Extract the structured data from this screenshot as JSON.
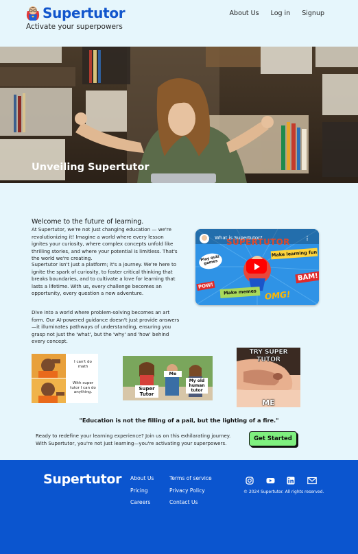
{
  "brand": {
    "name": "Supertutor",
    "tagline": "Activate your superpowers"
  },
  "nav": {
    "items": [
      "About Us",
      "Log in",
      "Signup"
    ]
  },
  "hero": {
    "title": "Unveiling Supertutor"
  },
  "intro": {
    "heading": "Welcome to the future of learning.",
    "paragraphs": [
      "At Supertutor, we're not just changing education — we're revolutionizing it! Imagine a world where every lesson ignites your curiosity, where complex concepts unfold like thrilling stories, and where your potential is limitless. That's the world we're creating.",
      "Supertutor isn't just a platform; it's a journey. We're here to ignite the spark of curiosity, to foster critical thinking that breaks boundaries, and to cultivate a love for learning that lasts a lifetime. With us, every challenge becomes an opportunity, every question a new adventure.",
      "Dive into a world where problem-solving becomes an art form. Our AI-powered guidance doesn't just provide answers—it illuminates pathways of understanding, ensuring you grasp not just the 'what', but the 'why' and 'how' behind every concept."
    ]
  },
  "video": {
    "title": "What is Supertutor?",
    "banner": "SUPERTUTOR",
    "stickers": [
      "Play quiz games",
      "Make learning fun",
      "Make memes",
      "OMG!",
      "BAM!",
      "POW!"
    ]
  },
  "memes": {
    "drake": {
      "top_caption": "I can't do math",
      "bottom_caption": "With super tutor I can do anything."
    },
    "distracted": {
      "left_label": "Super Tutor",
      "middle_label": "Me",
      "right_label": "My old human tutor"
    },
    "ear": {
      "top_text": "TRY SUPER TUTOR",
      "bottom_text": "ME"
    }
  },
  "quote": "\"Education is not the filling of a pail, but the lighting of a fire.\"",
  "cta": {
    "text": "Ready to redefine your learning experience? Join us on this exhilarating journey. With Supertutor, you're not just learning—you're activating your superpowers.",
    "button": "Get Started"
  },
  "footer": {
    "brand": "Supertutor",
    "col1": [
      "About Us",
      "Pricing",
      "Careers"
    ],
    "col2": [
      "Terms of service",
      "Privacy Policy",
      "Contact Us"
    ],
    "socials": [
      "instagram-icon",
      "youtube-icon",
      "linkedin-icon",
      "email-icon"
    ],
    "copyright": "© 2024 Supertutor. All rights reserved."
  },
  "colors": {
    "page_bg": "#e6f6fc",
    "brand_blue": "#1155cc",
    "footer_bg": "#0b55cf",
    "cta_green": "#7ff07f"
  }
}
